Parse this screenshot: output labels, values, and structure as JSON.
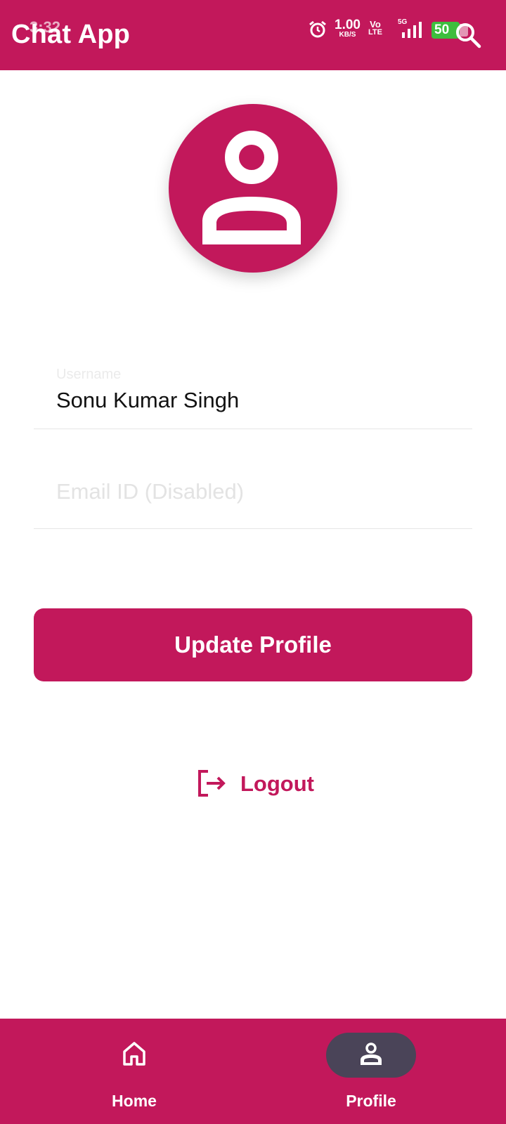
{
  "status_bar": {
    "time": "3:32",
    "net_speed": "1.00",
    "net_speed_unit": "KB/S",
    "volte_top": "Vo",
    "volte_bottom": "LTE",
    "network": "5G",
    "battery": "50"
  },
  "app_bar": {
    "title": "Chat App",
    "search_icon": "search-icon"
  },
  "profile": {
    "avatar_icon": "person-icon",
    "username_label": "Username",
    "username_value": "Sonu Kumar Singh",
    "email_placeholder": "Email ID (Disabled)",
    "update_button": "Update Profile",
    "logout_label": "Logout",
    "logout_icon": "logout-icon"
  },
  "bottom_nav": {
    "items": [
      {
        "label": "Home",
        "icon": "home-icon",
        "selected": false
      },
      {
        "label": "Profile",
        "icon": "person-icon",
        "selected": true
      }
    ]
  },
  "colors": {
    "primary": "#C2185B",
    "nav_indicator": "#4A4458",
    "battery": "#3DBE3D"
  }
}
